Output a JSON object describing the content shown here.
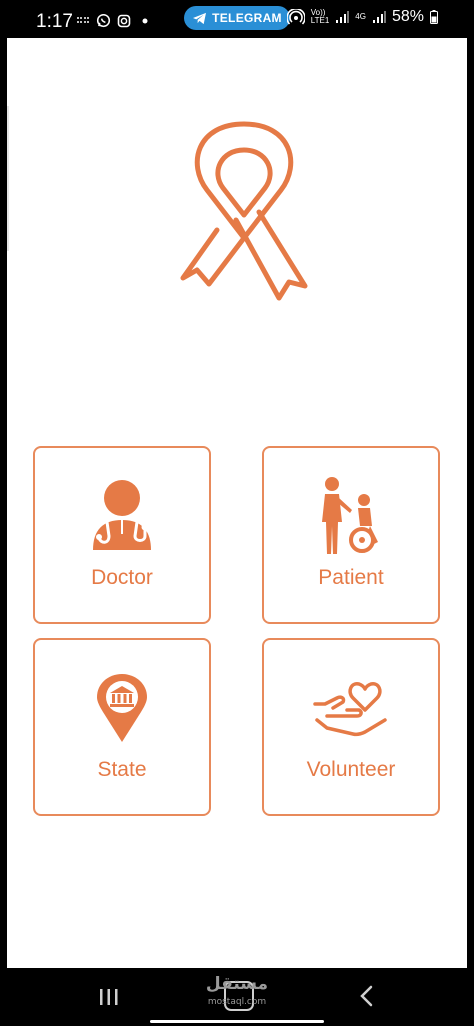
{
  "status_bar": {
    "time": "1:17",
    "notification_pill": "TELEGRAM",
    "network_left": "Vo))\nLTE1",
    "network_right": "4G",
    "battery": "58%"
  },
  "colors": {
    "accent": "#e57a46",
    "card_border": "#e88a5b",
    "background": "#ffffff",
    "telegram": "#2a8fd6"
  },
  "logo": {
    "icon": "awareness-ribbon-icon"
  },
  "roles": [
    {
      "label": "Doctor",
      "icon": "doctor-icon"
    },
    {
      "label": "Patient",
      "icon": "patient-wheelchair-icon"
    },
    {
      "label": "State",
      "icon": "state-building-pin-icon"
    },
    {
      "label": "Volunteer",
      "icon": "volunteer-heart-hand-icon"
    }
  ],
  "watermark": {
    "text": "مستقل",
    "sub": "mostaql.com"
  }
}
